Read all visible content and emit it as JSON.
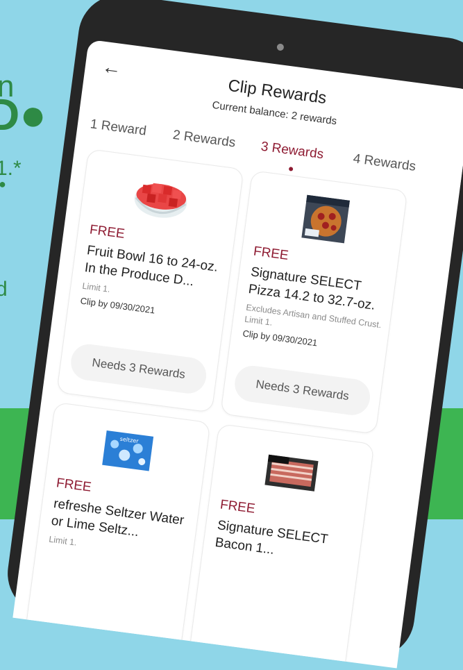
{
  "background": {
    "band_color": "#3db552",
    "sky_color": "#8fd6e8",
    "partial_text": [
      "n",
      "D●",
      "1.*",
      "●",
      "d"
    ]
  },
  "header": {
    "back_icon": "arrow-left-icon",
    "title": "Clip Rewards",
    "balance": "Current balance: 2 rewards"
  },
  "tabs": [
    {
      "label": "1 Reward",
      "active": false
    },
    {
      "label": "2 Rewards",
      "active": false
    },
    {
      "label": "3 Rewards",
      "active": true
    },
    {
      "label": "4 Rewards",
      "active": false
    }
  ],
  "accent_color": "#8e1b32",
  "rewards": [
    {
      "image": "watermelon-fruit-bowl-icon",
      "badge": "FREE",
      "name": "Fruit Bowl 16 to 24-oz. In the Produce D...",
      "note": "Limit 1.",
      "clip_by": "Clip by 09/30/2021",
      "button": "Needs 3 Rewards"
    },
    {
      "image": "pepperoni-pizza-box-icon",
      "badge": "FREE",
      "name": "Signature SELECT Pizza 14.2 to 32.7-oz.",
      "note": "Excludes Artisan and Stuffed Crust. Limit 1.",
      "clip_by": "Clip by 09/30/2021",
      "button": "Needs 3 Rewards"
    },
    {
      "image": "seltzer-box-icon",
      "image_label": "seltzer",
      "badge": "FREE",
      "name": "refreshe Seltzer Water or Lime Seltz...",
      "note": "Limit 1.",
      "clip_by": "",
      "button": ""
    },
    {
      "image": "bacon-package-icon",
      "badge": "FREE",
      "name": "Signature SELECT Bacon 1...",
      "note": "",
      "clip_by": "",
      "button": ""
    }
  ]
}
